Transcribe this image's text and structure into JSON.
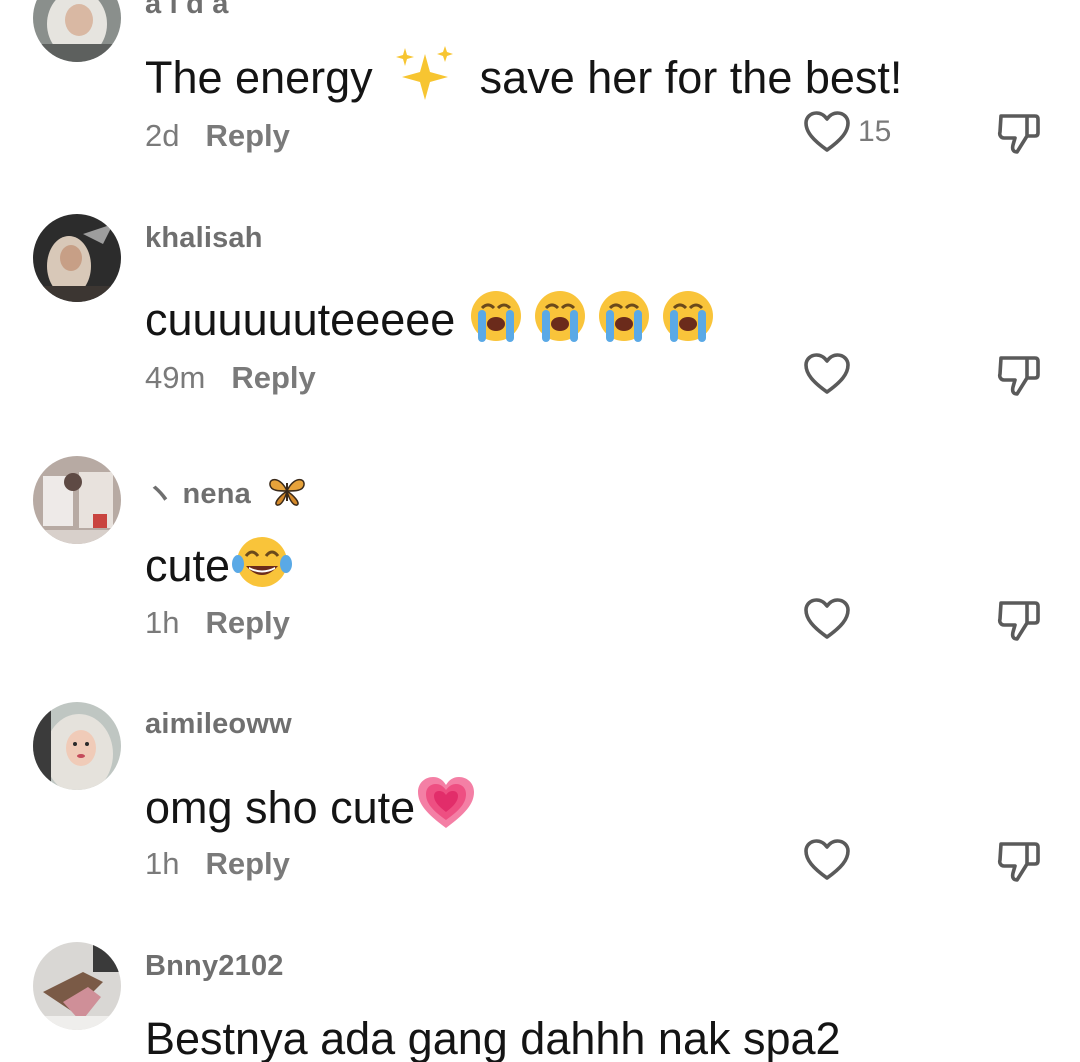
{
  "comments": [
    {
      "username": "a i d a",
      "text": "The energy",
      "text_emoji": "sparkles-emoji",
      "text_after": " save her for the best!",
      "time": "2d",
      "reply_label": "Reply",
      "like_count": "15",
      "avatar_icon": "avatar-photo"
    },
    {
      "username": "khalisah",
      "text": "cuuuuuuteeeee ",
      "text_emoji": "loudly-crying-face-emoji x4",
      "time": "49m",
      "reply_label": "Reply",
      "avatar_icon": "avatar-photo"
    },
    {
      "username_prefix": "ヽ",
      "username": "nena",
      "username_emoji": "butterfly-emoji",
      "text": "cute",
      "text_emoji": "tears-of-joy-emoji",
      "time": "1h",
      "reply_label": "Reply",
      "avatar_icon": "avatar-photo"
    },
    {
      "username": "aimileoww",
      "text": "omg sho cute",
      "text_emoji": "growing-heart-emoji",
      "time": "1h",
      "reply_label": "Reply",
      "avatar_icon": "avatar-photo"
    },
    {
      "username": "Bnny2102",
      "text": "Bestnya ada gang dahhh nak spa2",
      "avatar_icon": "avatar-photo"
    }
  ],
  "icons": {
    "like": "heart-outline-icon",
    "dislike": "thumbs-down-outline-icon"
  },
  "colors": {
    "text": "#141414",
    "secondary": "#7a7a7a",
    "icon": "#5a5a5a"
  }
}
